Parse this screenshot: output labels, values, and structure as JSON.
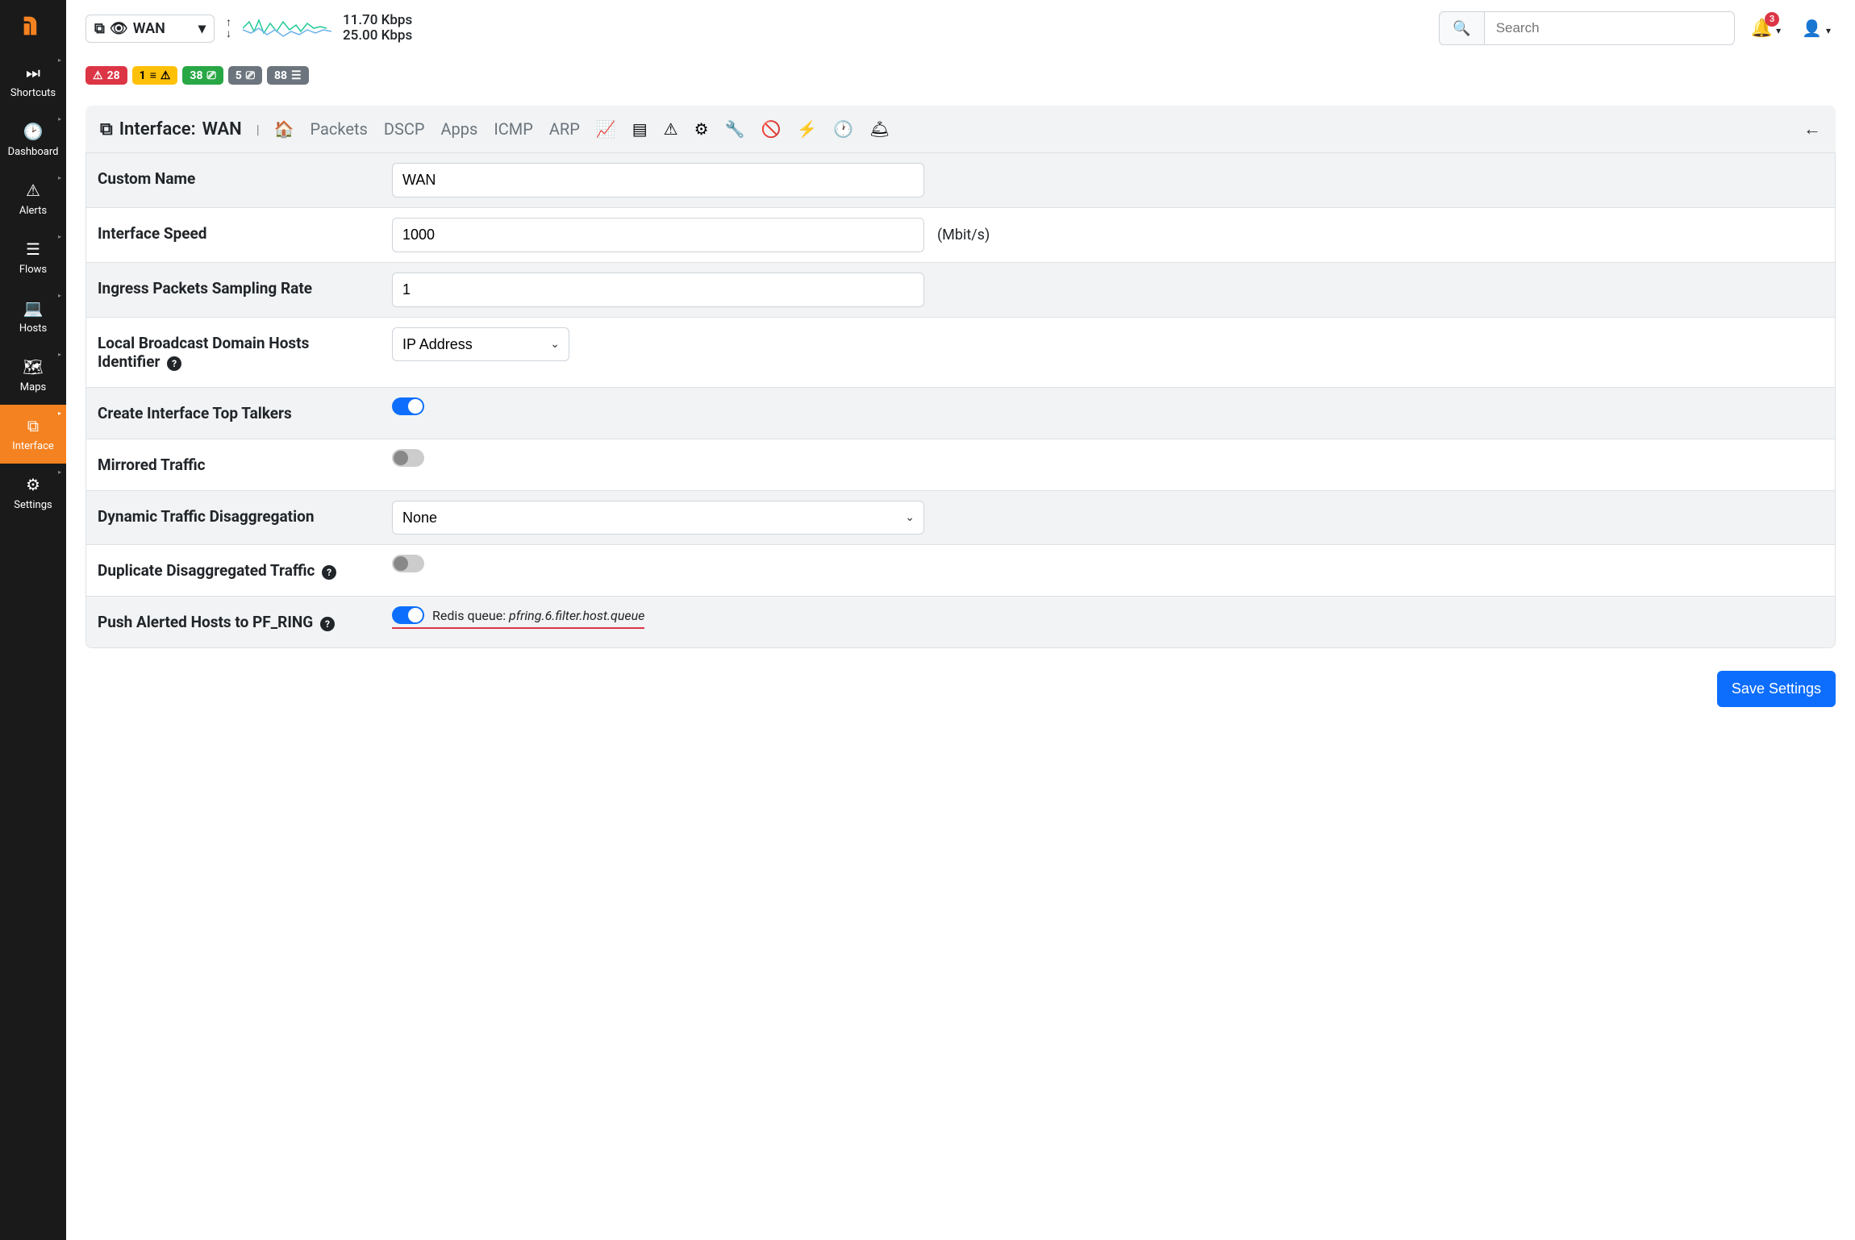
{
  "sidebar": {
    "items": [
      {
        "label": "Shortcuts"
      },
      {
        "label": "Dashboard"
      },
      {
        "label": "Alerts"
      },
      {
        "label": "Flows"
      },
      {
        "label": "Hosts"
      },
      {
        "label": "Maps"
      },
      {
        "label": "Interface"
      },
      {
        "label": "Settings"
      }
    ]
  },
  "topbar": {
    "interface_label": "WAN",
    "rate_up": "11.70 Kbps",
    "rate_down": "25.00 Kbps",
    "search_placeholder": "Search",
    "bell_count": "3",
    "badges": {
      "alerts": "28",
      "engaged": "1",
      "hosts": "38",
      "local": "5",
      "flows": "88"
    }
  },
  "header": {
    "title_prefix": "Interface:",
    "title": "WAN",
    "tabs": {
      "packets": "Packets",
      "dscp": "DSCP",
      "apps": "Apps",
      "icmp": "ICMP",
      "arp": "ARP"
    }
  },
  "form": {
    "custom_name_label": "Custom Name",
    "custom_name_value": "WAN",
    "speed_label": "Interface Speed",
    "speed_value": "1000",
    "speed_unit": "(Mbit/s)",
    "sampling_label": "Ingress Packets Sampling Rate",
    "sampling_value": "1",
    "hosts_id_label": "Local Broadcast Domain Hosts Identifier",
    "hosts_id_value": "IP Address",
    "top_talkers_label": "Create Interface Top Talkers",
    "mirrored_label": "Mirrored Traffic",
    "disagg_label": "Dynamic Traffic Disaggregation",
    "disagg_value": "None",
    "dup_disagg_label": "Duplicate Disaggregated Traffic",
    "pfring_label": "Push Alerted Hosts to PF_RING",
    "redis_prefix": "Redis queue: ",
    "redis_queue": "pfring.6.filter.host.queue"
  },
  "buttons": {
    "save": "Save Settings"
  }
}
